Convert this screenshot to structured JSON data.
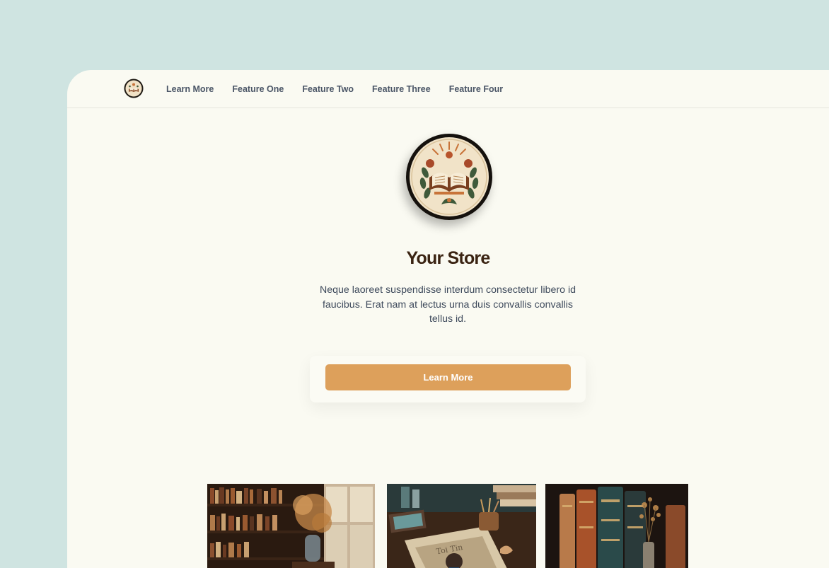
{
  "nav": {
    "links": [
      "Learn More",
      "Feature One",
      "Feature Two",
      "Feature Three",
      "Feature Four"
    ]
  },
  "hero": {
    "title": "Your Store",
    "description": "Neque laoreet suspendisse interdum consectetur libero id faucibus. Erat nam at lectus urna duis convallis convallis tellus id.",
    "cta_label": "Learn More"
  },
  "images": [
    {
      "name": "bookshelf-window-photo"
    },
    {
      "name": "desk-book-photo"
    },
    {
      "name": "old-books-photo"
    }
  ],
  "colors": {
    "backdrop": "#cfe4e1",
    "page": "#fafaf2",
    "title": "#3a2312",
    "text": "#3e4a5c",
    "accent": "#dda05b"
  }
}
